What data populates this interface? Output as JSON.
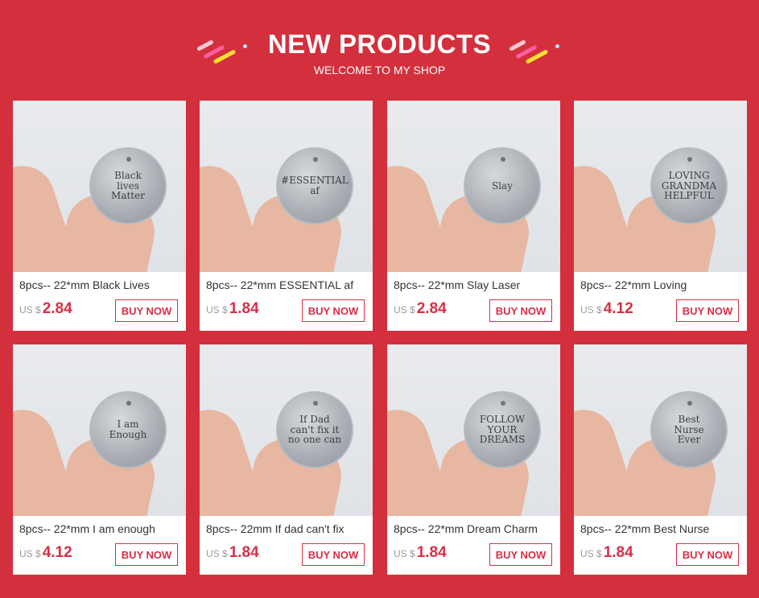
{
  "header": {
    "title": "NEW PRODUCTS",
    "subtitle": "WELCOME TO MY SHOP"
  },
  "colors": {
    "background": "#d32f3c",
    "accent": "#d72f46"
  },
  "products": [
    {
      "name": "8pcs-- 22*mm Black Lives",
      "currency": "US $",
      "price": "2.84",
      "buy": "BUY NOW",
      "coin_text": "Black\nlives\nMatter"
    },
    {
      "name": "8pcs-- 22*mm ESSENTIAL af",
      "currency": "US $",
      "price": "1.84",
      "buy": "BUY NOW",
      "coin_text": "#ESSENTIAL\naf"
    },
    {
      "name": "8pcs-- 22*mm Slay Laser",
      "currency": "US $",
      "price": "2.84",
      "buy": "BUY NOW",
      "coin_text": "Slay"
    },
    {
      "name": "8pcs-- 22*mm Loving",
      "currency": "US $",
      "price": "4.12",
      "buy": "BUY NOW",
      "coin_text": "LOVING\nGRANDMA\nHELPFUL"
    },
    {
      "name": "8pcs-- 22*mm I am enough",
      "currency": "US $",
      "price": "4.12",
      "buy": "BUY NOW",
      "coin_text": "I am\nEnough"
    },
    {
      "name": "8pcs-- 22mm If dad can't fix",
      "currency": "US $",
      "price": "1.84",
      "buy": "BUY NOW",
      "coin_text": "If Dad\ncan't fix it\nno one can"
    },
    {
      "name": "8pcs-- 22*mm Dream Charm",
      "currency": "US $",
      "price": "1.84",
      "buy": "BUY NOW",
      "coin_text": "FOLLOW\nYOUR\nDREAMS"
    },
    {
      "name": "8pcs-- 22*mm Best Nurse",
      "currency": "US $",
      "price": "1.84",
      "buy": "BUY NOW",
      "coin_text": "Best\nNurse\nEver"
    }
  ]
}
